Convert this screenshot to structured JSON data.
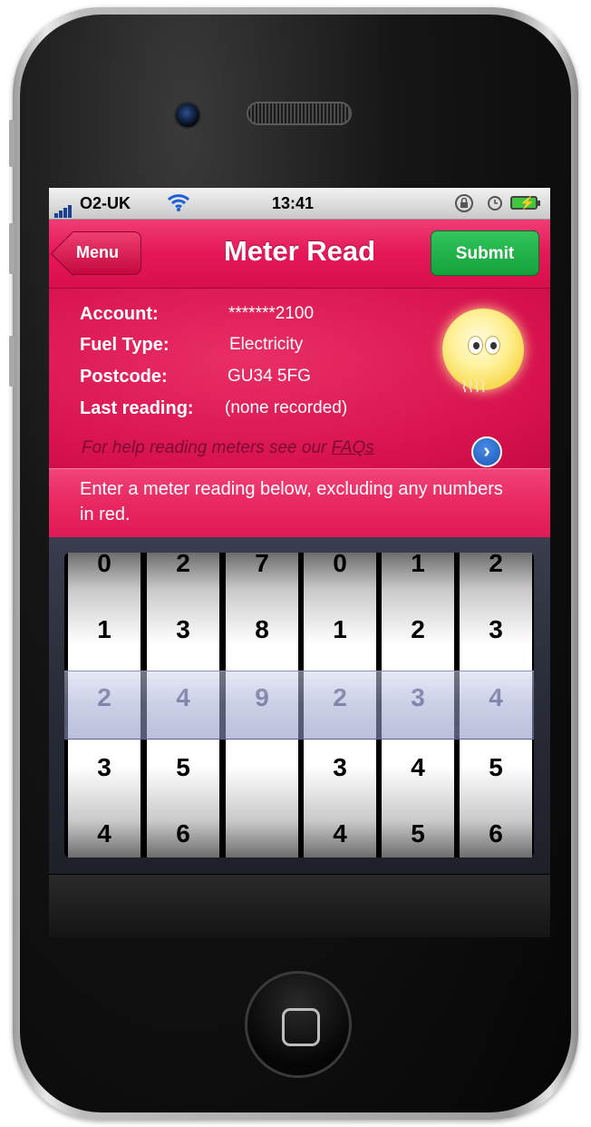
{
  "status_bar": {
    "carrier": "O2-UK",
    "time": "13:41",
    "icons": [
      "signal-icon",
      "wifi-icon",
      "rotation-lock-icon",
      "alarm-icon",
      "battery-charging-icon"
    ]
  },
  "nav": {
    "back_label": "Menu",
    "title": "Meter Read",
    "submit_label": "Submit"
  },
  "account_info": {
    "account_label": "Account:",
    "account_value": "*******2100",
    "fuel_label": "Fuel Type:",
    "fuel_value": "Electricity",
    "postcode_label": "Postcode:",
    "postcode_value": "GU34 5FG",
    "last_reading_label": "Last reading:",
    "last_reading_value": "(none recorded)",
    "help_text": "For help reading meters see our ",
    "faq_link": "FAQs"
  },
  "instruction": "Enter a meter reading below, excluding any numbers in red.",
  "picker": {
    "wheels": [
      {
        "digits": [
          "0",
          "1",
          "2",
          "3",
          "4"
        ],
        "selected": "2"
      },
      {
        "digits": [
          "2",
          "3",
          "4",
          "5",
          "6"
        ],
        "selected": "4"
      },
      {
        "digits": [
          "7",
          "8",
          "9",
          "",
          ""
        ],
        "selected": "9"
      },
      {
        "digits": [
          "0",
          "1",
          "2",
          "3",
          "4"
        ],
        "selected": "2"
      },
      {
        "digits": [
          "1",
          "2",
          "3",
          "4",
          "5"
        ],
        "selected": "3"
      },
      {
        "digits": [
          "2",
          "3",
          "4",
          "5",
          "6"
        ],
        "selected": "4"
      }
    ]
  },
  "colors": {
    "brand_pink": "#e51758",
    "submit_green": "#1fae46",
    "help_text": "#7a0a30"
  }
}
